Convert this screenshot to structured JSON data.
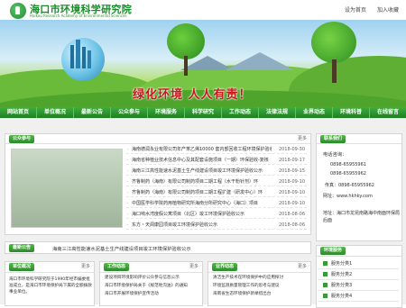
{
  "header": {
    "title": "海口市环境科学研究院",
    "subtitle": "Haikou Research Academy of Environmental Sciences",
    "links": [
      "设为首页",
      "加入收藏"
    ]
  },
  "banner": {
    "slogan": "绿化环境  人人有责！"
  },
  "nav": [
    "网站首页",
    "单位概况",
    "最新公告",
    "公众参与",
    "环境服务",
    "科学研究",
    "工作动态",
    "法律法规",
    "业界动态",
    "环境科普",
    "在线留言"
  ],
  "public": {
    "label": "公众参与",
    "more": "更多",
    "items": [
      {
        "title": "海南德润永业有限公司年产苯乙烯10000 套内部回收工程环境保护验收",
        "date": "2018-09-30"
      },
      {
        "title": "海南省种植业技术信息中心及其配套设施项目（一期）环保验收-复核",
        "date": "2018-09-17"
      },
      {
        "title": "海南三江高性能速水泥基土生产线建设项目竣工环境保护验收公示",
        "date": "2018-09-15"
      },
      {
        "title": "齐鲁制药（海南）有限公司制药项目二期工程（水干粉针剂）环",
        "date": "2018-09-10"
      },
      {
        "title": "齐鲁制药（海南）有限公司制药项目二期工程扩建（研发中心）环",
        "date": "2018-09-10"
      },
      {
        "title": "中国医学科学院药用植物研究所海南分所研究中心（海口）项目",
        "date": "2018-09-10"
      },
      {
        "title": "海口响水湾度假公寓项目（北区）竣工环境保护验收公示",
        "date": "2018-08-06"
      },
      {
        "title": "东方・天阆康园项目竣工环境保护验收公示",
        "date": "2018-08-06"
      }
    ]
  },
  "notice": {
    "label": "最新公告",
    "text": "海南三江高性能速水泥基土生产线建设项目竣工环境保护验收公示"
  },
  "contact": {
    "label": "联系我们",
    "phone_label": "电话咨询：",
    "phones": [
      "0898-65955961",
      "0898-65955962"
    ],
    "fax": "传真：0898-65955962",
    "web": "网址：www.hkhky.com",
    "address": "地址：海口市龙昆南路海中南面环保局后面"
  },
  "services": {
    "label": "环境服务",
    "items": [
      "服务分类1",
      "服务分类2",
      "服务分类3",
      "服务分类4"
    ]
  },
  "about": {
    "label": "单位概况",
    "more": "更多",
    "text": "海口市环境科学研究院于1990年经市编委批准成立，是海口市环境保护局下属的全额拨款事业单位。"
  },
  "work": {
    "label": "工作动态",
    "more": "更多",
    "items": [
      "建设项目环境影响评价公众参与信息公示",
      "海口市环境保护局关于《规范地沟油》的通知",
      "海口市开展环境保护宣传活动"
    ]
  },
  "industry": {
    "label": "业界动态",
    "more": "更多",
    "items": [
      "清洁生产技术在环境保护中的应用探讨",
      "环境监测质量管理工作的思考与建议",
      "海南省生态环境保护新举措出台"
    ]
  }
}
